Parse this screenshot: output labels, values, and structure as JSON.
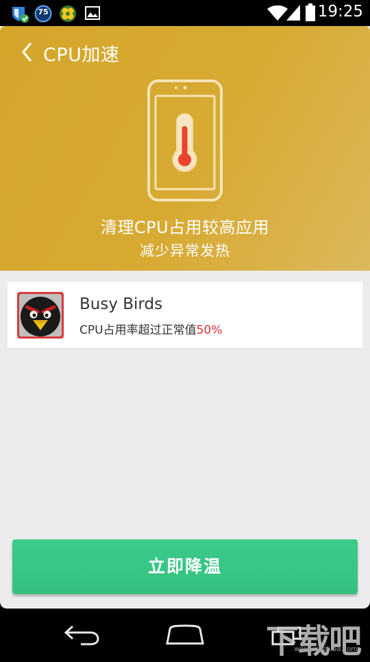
{
  "status_bar": {
    "time": "19:25",
    "notification_badge": "75",
    "icons": [
      "shield-check-icon",
      "speed-badge-icon",
      "clover-app-icon",
      "image-icon",
      "wifi-icon",
      "signal-icon",
      "battery-icon"
    ]
  },
  "header": {
    "title": "CPU加速",
    "line1": "清理CPU占用较高应用",
    "line2": "减少异常发热"
  },
  "apps": [
    {
      "name": "Busy Birds",
      "desc_prefix": "CPU占用率超过正常值",
      "desc_value": "50%"
    }
  ],
  "action_button": {
    "label": "立即降温"
  },
  "watermark": {
    "text": "下载吧",
    "sub": "www.xiazaiba.com"
  },
  "colors": {
    "header": "#d6a82e",
    "button": "#39c585",
    "highlight": "#e02d2d"
  }
}
